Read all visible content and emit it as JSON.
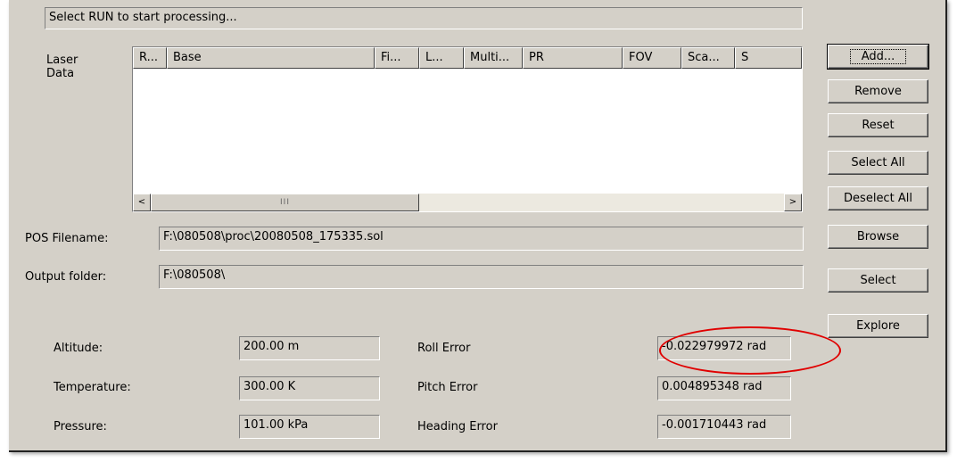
{
  "status_text": "Select RUN to start processing...",
  "laser_data": {
    "label": "Laser\nData",
    "columns": [
      "R...",
      "Base",
      "Fi...",
      "L...",
      "Multi...",
      "PR",
      "FOV",
      "Sca...",
      "S"
    ],
    "rows": [],
    "scrollbar": {
      "left_arrow": "<",
      "thumb_grip": "III",
      "right_arrow": ">"
    }
  },
  "buttons": {
    "add": "Add...",
    "remove": "Remove",
    "reset": "Reset",
    "select_all": "Select All",
    "deselect_all": "Deselect All",
    "browse": "Browse",
    "select": "Select",
    "explore": "Explore"
  },
  "pos_filename": {
    "label": "POS Filename:",
    "value": "F:\\080508\\proc\\20080508_175335.sol"
  },
  "output_folder": {
    "label": "Output folder:",
    "value": "F:\\080508\\"
  },
  "params": {
    "altitude": {
      "label": "Altitude:",
      "value": "200.00 m"
    },
    "temperature": {
      "label": "Temperature:",
      "value": "300.00 K"
    },
    "pressure": {
      "label": "Pressure:",
      "value": "101.00 kPa"
    }
  },
  "errors": {
    "roll": {
      "label": "Roll Error",
      "value": "-0.022979972 rad"
    },
    "pitch": {
      "label": "Pitch Error",
      "value": "0.004895348 rad"
    },
    "heading": {
      "label": "Heading Error",
      "value": "-0.001710443 rad"
    }
  },
  "annotation_color": "#e00000"
}
